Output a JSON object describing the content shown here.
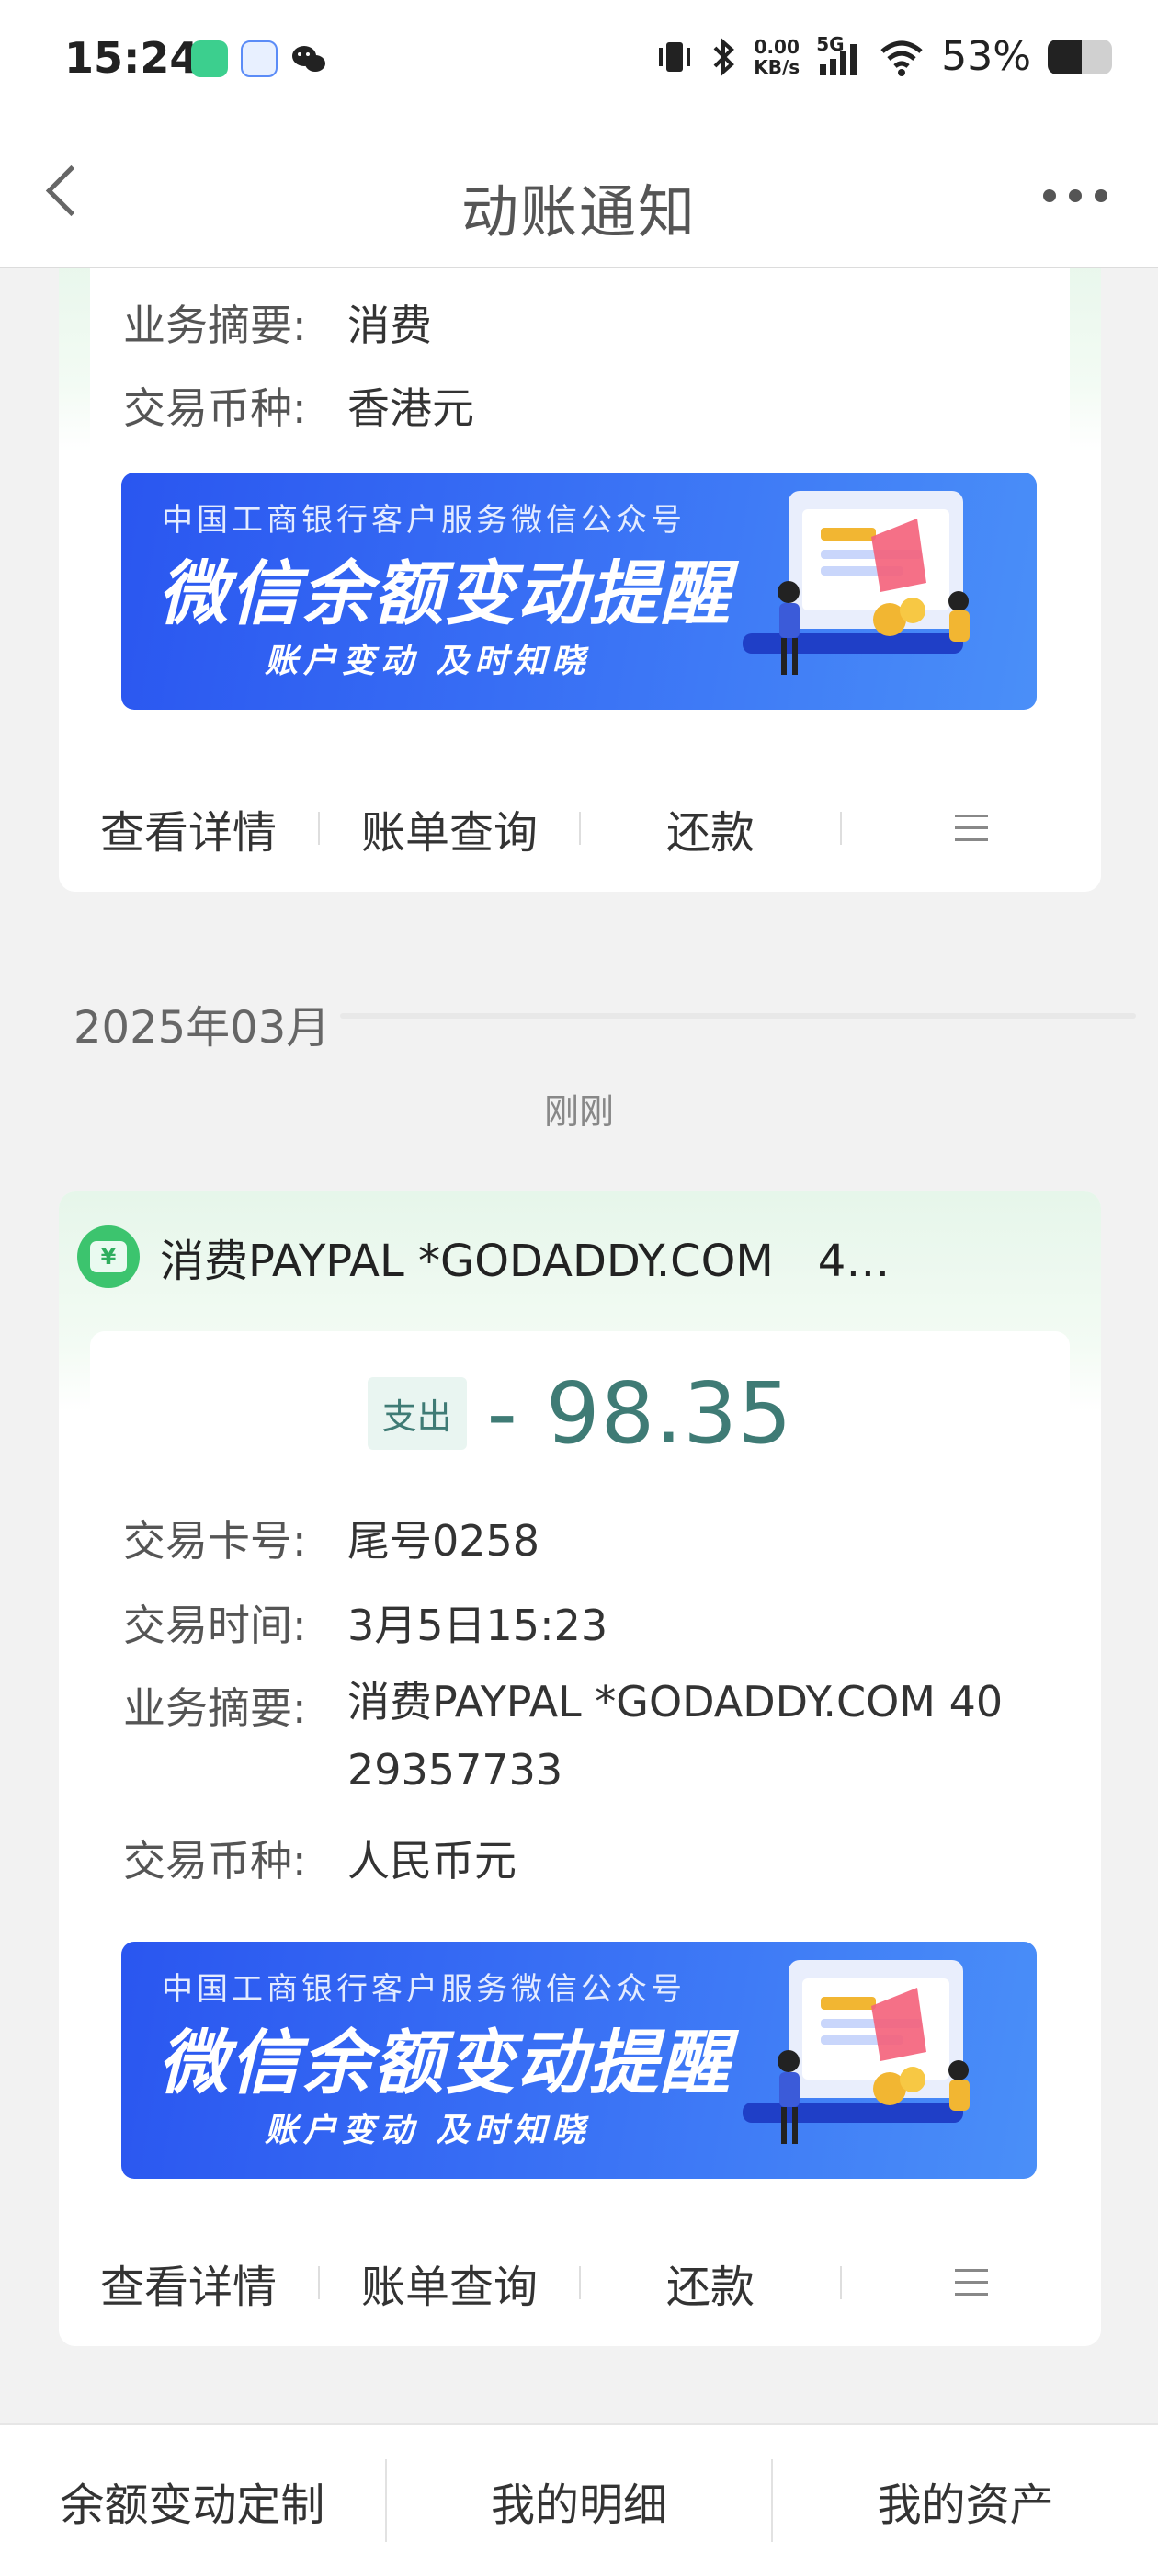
{
  "status_bar": {
    "time": "15:24",
    "network_speed": "0.00",
    "network_unit": "KB/s",
    "network_type": "5G",
    "battery": "53%",
    "battery_level": 0.53
  },
  "nav": {
    "title": "动账通知"
  },
  "card1": {
    "rows": [
      {
        "label": "业务摘要:",
        "value": "消费"
      },
      {
        "label": "交易币种:",
        "value": "香港元"
      }
    ]
  },
  "banner": {
    "line1": "中国工商银行客户服务微信公众号",
    "line2": "微信余额变动提醒",
    "line3": "账户变动 及时知晓"
  },
  "actions": {
    "details": "查看详情",
    "bill_query": "账单查询",
    "repay": "还款",
    "menu_icon": "menu-icon"
  },
  "month_header": "2025年03月",
  "timestamp": "刚刚",
  "card2": {
    "icon": "yuan-icon",
    "icon_glyph": "¥",
    "title": "消费PAYPAL *GODADDY.COM　4…",
    "tag": "支出",
    "amount": "- 98.35",
    "rows": [
      {
        "label": "交易卡号:",
        "value": "尾号0258"
      },
      {
        "label": "交易时间:",
        "value": "3月5日15:23"
      },
      {
        "label": "业务摘要:",
        "value": "消费PAYPAL *GODADDY.COM 4029357733"
      },
      {
        "label": "交易币种:",
        "value": "人民币元"
      }
    ]
  },
  "tabbar": {
    "tabs": [
      "余额变动定制",
      "我的明细",
      "我的资产"
    ]
  },
  "colors": {
    "accent": "#3f7b75",
    "banner_blue": "#2a56f0",
    "green_icon": "#3cc46e"
  }
}
